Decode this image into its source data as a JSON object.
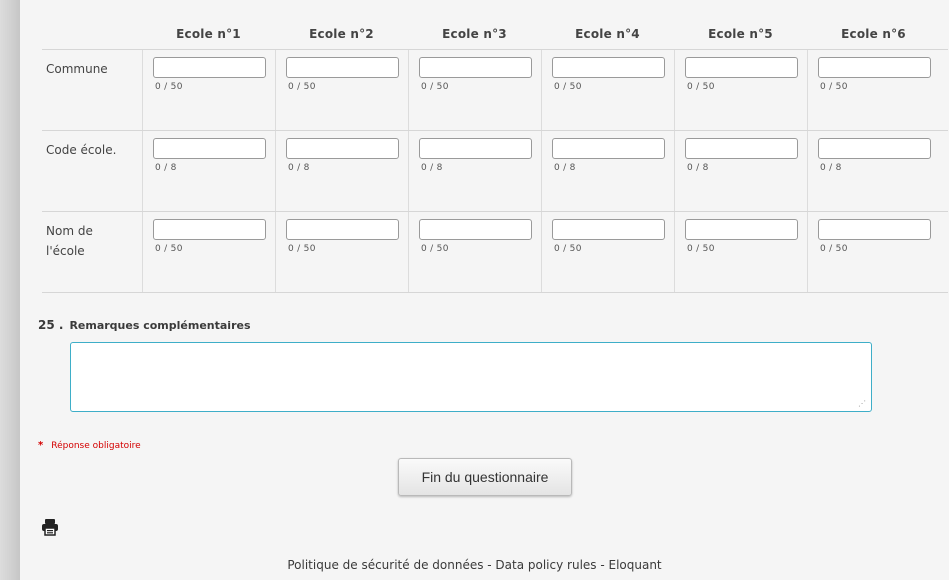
{
  "grid": {
    "columns": [
      "Ecole n°1",
      "Ecole n°2",
      "Ecole n°3",
      "Ecole n°4",
      "Ecole n°5",
      "Ecole n°6"
    ],
    "rows": [
      {
        "label": "Commune",
        "counter": "0 / 50"
      },
      {
        "label": "Code école.",
        "counter": "0 / 8"
      },
      {
        "label": "Nom de l'école",
        "counter": "0 / 50"
      }
    ]
  },
  "question": {
    "number": "25 .",
    "title": "Remarques complémentaires",
    "value": ""
  },
  "required": {
    "star": "*",
    "text": "Réponse obligatoire"
  },
  "submit_label": "Fin du questionnaire",
  "print_icon": "printer-icon",
  "footer": "Politique de sécurité de données - Data policy rules - Eloquant",
  "colors": {
    "accent": "#3eaec8",
    "required": "#d40000"
  }
}
